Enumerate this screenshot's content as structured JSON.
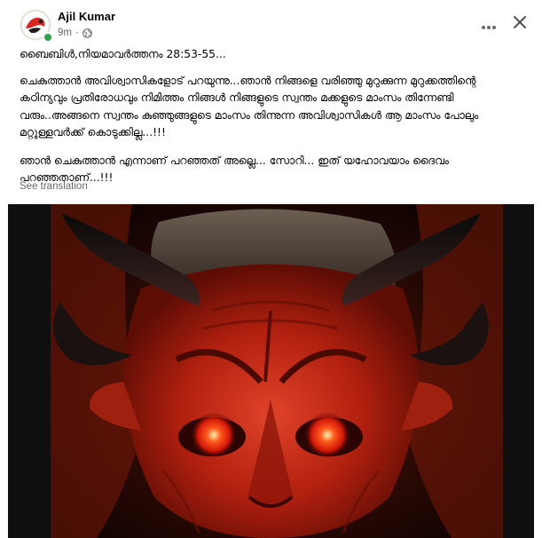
{
  "post": {
    "author": "Ajil Kumar",
    "time": "9m",
    "privacy_icon": "globe-icon",
    "more_icon": "more-horizontal-icon",
    "close_icon": "close-icon",
    "paragraphs": [
      "ബൈബിൾ,നിയമാവർത്തനം 28:53-55...",
      "ചെകുത്താൻ അവിശ്വാസികളോട് പറയുന്നു...ഞാൻ നിങ്ങളെ വരിഞ്ഞു മുറുക്കുന്ന മുറുക്കത്തിന്റെ കഠിന്യവും പ്രതിരോധവും നിമിത്തം നിങ്ങൾ നിങ്ങളുടെ സ്വന്തം മക്കളുടെ മാംസം തിന്നേണ്ടി വരും..അങ്ങനെ സ്വന്തം കുഞ്ഞുങ്ങളുടെ മാംസം തിന്നുന്ന അവിശ്വാസികൾ ആ മാംസം പോലും മറ്റുള്ളവർക്ക് കൊടുക്കില്ല...!!!",
      "ഞാൻ ചെകുത്താൻ എന്നാണ് പറഞ്ഞത് അല്ലെ... സോറി... ഇത് യഹോവയാം ദൈവം പറഞ്ഞതാണ്...!!!"
    ],
    "see_translation": "See translation"
  },
  "colors": {
    "text_primary": "#050505",
    "text_secondary": "#65676b",
    "online": "#31a24c",
    "image_red": "#b3200f",
    "eye_glow": "#ff3a1a"
  }
}
